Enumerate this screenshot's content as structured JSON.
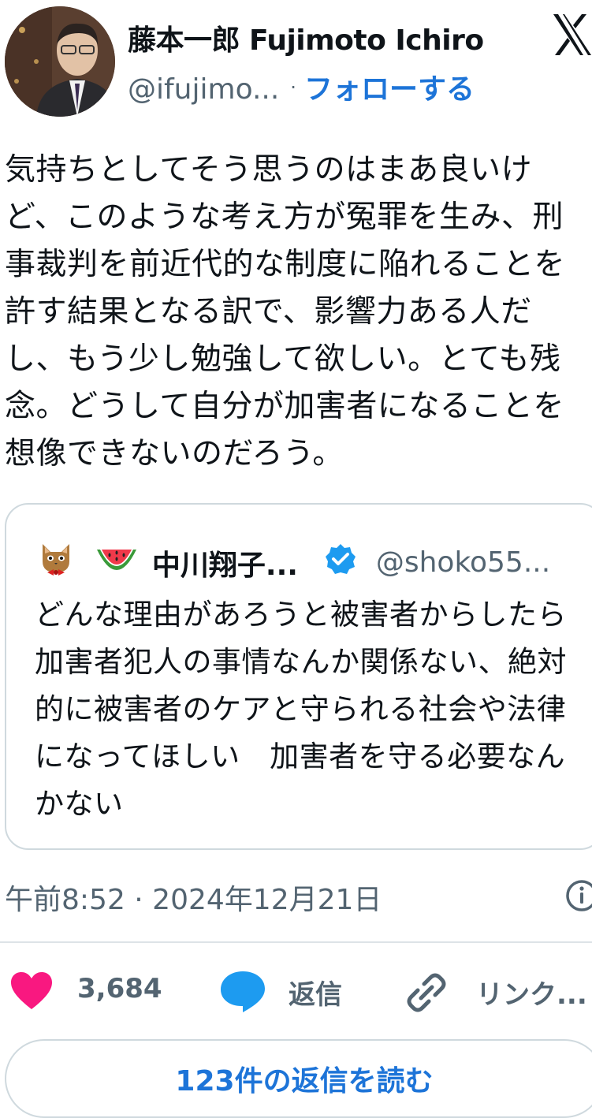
{
  "author": {
    "display_name": "藤本一郎 Fujimoto Ichiro",
    "handle": "@ifujimo...",
    "separator": "·",
    "follow_label": "フォローする"
  },
  "tweet": {
    "text": "気持ちとしてそう思うのはまあ良いけど、このような考え方が冤罪を生み、刑事裁判を前近代的な制度に陥れることを許す結果となる訳で、影響力ある人だし、もう少し勉強して欲しい。とても残念。どうして自分が加害者になることを想像できないのだろう。"
  },
  "quoted_tweet": {
    "emoji_icons": [
      "cat-face-with-bowtie-icon",
      "watermelon-icon"
    ],
    "name": "中川翔子...",
    "verified_icon": "verified-badge-icon",
    "handle": "@shoko55...",
    "text": "どんな理由があろうと被害者からしたら加害者犯人の事情なんか関係ない、絶対的に被害者のケアと守られる社会や法律になってほしい　加害者を守る必要なんかない"
  },
  "meta": {
    "timestamp": "午前8:52 · 2024年12月21日"
  },
  "actions": {
    "like_count": "3,684",
    "reply_label": "返信",
    "link_label": "リンク..."
  },
  "footer": {
    "read_replies_label": "123件の返信を読む"
  },
  "colors": {
    "accent": "#1d74d8",
    "like": "#f91880",
    "reply": "#1d9bf0",
    "muted": "#536471"
  }
}
